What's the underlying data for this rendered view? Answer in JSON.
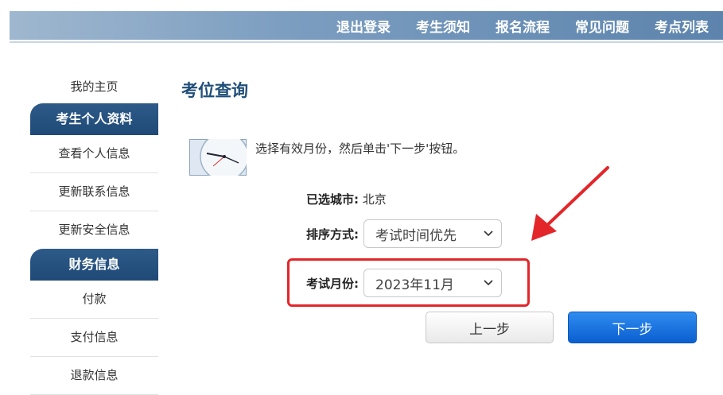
{
  "nav": {
    "items": [
      "退出登录",
      "考生须知",
      "报名流程",
      "常见问题",
      "考点列表"
    ]
  },
  "sidebar": {
    "home": "我的主页",
    "section1": {
      "header": "考生个人资料",
      "items": [
        "查看个人信息",
        "更新联系信息",
        "更新安全信息"
      ]
    },
    "section2": {
      "header": "财务信息",
      "items": [
        "付款",
        "支付信息",
        "退款信息"
      ]
    }
  },
  "main": {
    "title": "考位查询",
    "instruction": "选择有效月份，然后单击'下一步'按钮。",
    "city_label": "已选城市:",
    "city_value": "北京",
    "sort_label": "排序方式:",
    "sort_value": "考试时间优先",
    "month_label": "考试月份:",
    "month_value": "2023年11月",
    "prev_button": "上一步",
    "next_button": "下一步"
  },
  "colors": {
    "nav_bar": "#6f94bb",
    "sidebar_header": "#1f4a78",
    "title": "#1f4e79",
    "highlight": "#e3262a",
    "primary_button": "#1766d6"
  }
}
